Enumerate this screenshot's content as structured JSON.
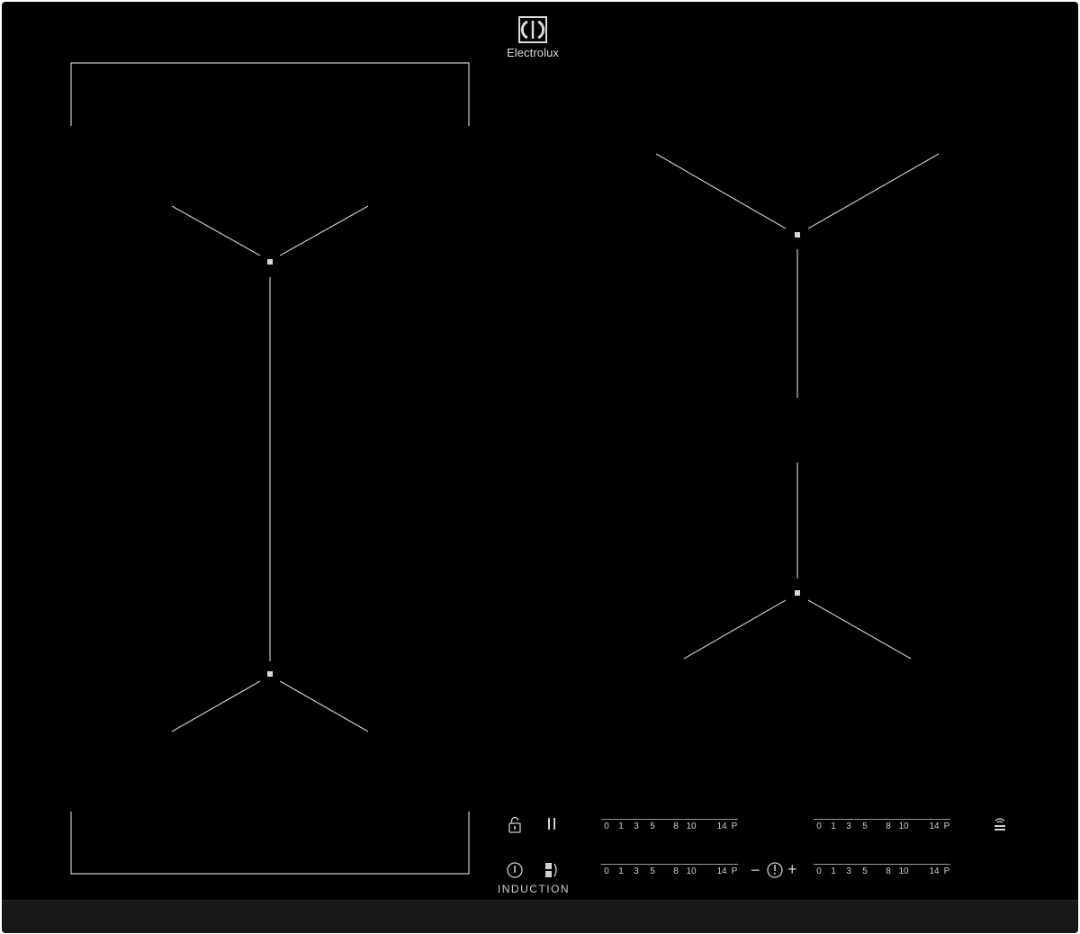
{
  "brand": {
    "name": "Electrolux",
    "logo_icon": "electrolux-logo-icon"
  },
  "panel": {
    "label": "INDUCTION"
  },
  "power_scale": [
    "0",
    "1",
    "3",
    "5",
    "8",
    "10",
    "14",
    "P"
  ],
  "controls": {
    "lock_icon": "lock-icon",
    "pause_icon": "pause-icon",
    "power_icon": "power-icon",
    "bridge_icon": "bridge-icon",
    "timer_icon": "timer-icon",
    "hob2hood_icon": "hob2hood-icon",
    "timer_minus": "−",
    "timer_plus": "+"
  },
  "colors": {
    "surface": "#000000",
    "print": "#cfcfcf",
    "edge": "#181818"
  }
}
